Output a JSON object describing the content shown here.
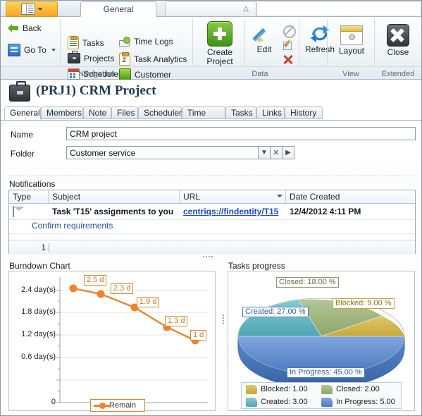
{
  "ribbon": {
    "app_button_icon": "book-menu-icon",
    "tabs": [
      {
        "label": "General",
        "active": true
      }
    ],
    "collapse_icon": "chevron-up-icon",
    "groups": [
      {
        "name": "Navigation",
        "label": "Navigation",
        "items": [
          {
            "label": "Back",
            "icon": "back-arrow-icon"
          },
          {
            "label": "Go To",
            "icon": "goto-icon",
            "has_dropdown": true
          },
          {
            "label": "Tasks",
            "icon": "clipboard-icon"
          },
          {
            "label": "Projects",
            "icon": "briefcase-icon"
          },
          {
            "label": "Scheduler",
            "icon": "calendar-icon"
          },
          {
            "label": "Time Logs",
            "icon": "timelog-icon"
          },
          {
            "label": "Task Analytics",
            "icon": "analytics-clipboard-icon"
          },
          {
            "label": "Customer",
            "icon": "customer-square-icon"
          }
        ]
      },
      {
        "name": "Data",
        "label": "Data",
        "items": [
          {
            "label": "Create Project",
            "icon": "green-plus-icon"
          },
          {
            "label": "Edit",
            "icon": "pencil-icon"
          },
          {
            "label": "",
            "icon": "ban-icon"
          },
          {
            "label": "",
            "icon": "edit-small-icon"
          },
          {
            "label": "",
            "icon": "delete-x-icon"
          },
          {
            "label": "Refresh",
            "icon": "refresh-icon"
          }
        ]
      },
      {
        "name": "View",
        "label": "View",
        "items": [
          {
            "label": "Layout",
            "icon": "layout-icon"
          }
        ]
      },
      {
        "name": "Extended",
        "label": "Extended",
        "items": [
          {
            "label": "Close",
            "icon": "close-x-icon"
          }
        ]
      }
    ]
  },
  "header": {
    "icon": "briefcase-icon",
    "title": "(PRJ1) CRM Project"
  },
  "page_tabs": [
    {
      "label": "General",
      "active": true
    },
    {
      "label": "Members",
      "active": false
    },
    {
      "label": "Note",
      "active": false
    },
    {
      "label": "Files",
      "active": false
    },
    {
      "label": "Scheduler",
      "active": false
    },
    {
      "label": "Time Logs",
      "active": false
    },
    {
      "label": "Tasks",
      "active": false
    },
    {
      "label": "Links",
      "active": false
    },
    {
      "label": "History",
      "active": false
    }
  ],
  "form": {
    "name_label": "Name",
    "name_value": "CRM project",
    "folder_label": "Folder",
    "folder_value": "Customer service",
    "folder_dropdown_icon": "chevron-down-icon",
    "folder_clear_icon": "clear-x-icon",
    "folder_open_icon": "open-arrow-icon"
  },
  "notifications": {
    "label": "Notifications",
    "columns": [
      "Type",
      "Subject",
      "URL",
      "Date Created"
    ],
    "sorted_column": "URL",
    "rows": [
      {
        "type_icon": "mail-icon",
        "subject": "Task 'T15' assignments to you",
        "url": "centriqs://findentity/T15",
        "date_created": "12/4/2012 4:11 PM",
        "sub_text": "Confirm requirements"
      }
    ],
    "footer_count": "1"
  },
  "burndown": {
    "title": "Burndown Chart",
    "legend_label": "Remain"
  },
  "tasks_progress": {
    "title": "Tasks progress"
  },
  "chart_data": [
    {
      "type": "line",
      "title": "Burndown Chart",
      "xlabel": "",
      "ylabel": "",
      "ylim": [
        0,
        3.0
      ],
      "yticks": [
        "0",
        "0.6 day(s)",
        "1.2 day(s)",
        "1.8 day(s)",
        "2.4 day(s)"
      ],
      "ytick_values": [
        0,
        0.6,
        1.2,
        1.8,
        2.4
      ],
      "grid": true,
      "legend_position": "bottom",
      "series": [
        {
          "name": "Remain",
          "color": "#f0822d",
          "x": [
            1,
            2,
            3,
            4,
            5
          ],
          "values": [
            2.5,
            2.3,
            1.9,
            1.3,
            1.0
          ],
          "point_labels": [
            "2.5 d",
            "2.3 d",
            "1.9 d",
            "1.3 d",
            "1 d"
          ]
        }
      ]
    },
    {
      "type": "pie",
      "title": "Tasks progress",
      "legend_position": "bottom",
      "labels": [
        "Blocked",
        "Closed",
        "Created",
        "In Progress"
      ],
      "values": [
        1.0,
        2.0,
        3.0,
        5.0
      ],
      "percents": [
        9.0,
        18.0,
        27.0,
        45.0
      ],
      "colors": [
        "#d4b44f",
        "#9cb37a",
        "#63b5c1",
        "#5b8ace"
      ],
      "slice_labels": [
        "Blocked: 9.00 %",
        "Closed: 18.00 %",
        "Created: 27.00 %",
        "In Progress: 45.00 %"
      ],
      "legend_entries": [
        "Blocked: 1.00",
        "Closed: 2.00",
        "Created: 3.00",
        "In Progress: 5.00"
      ]
    }
  ]
}
